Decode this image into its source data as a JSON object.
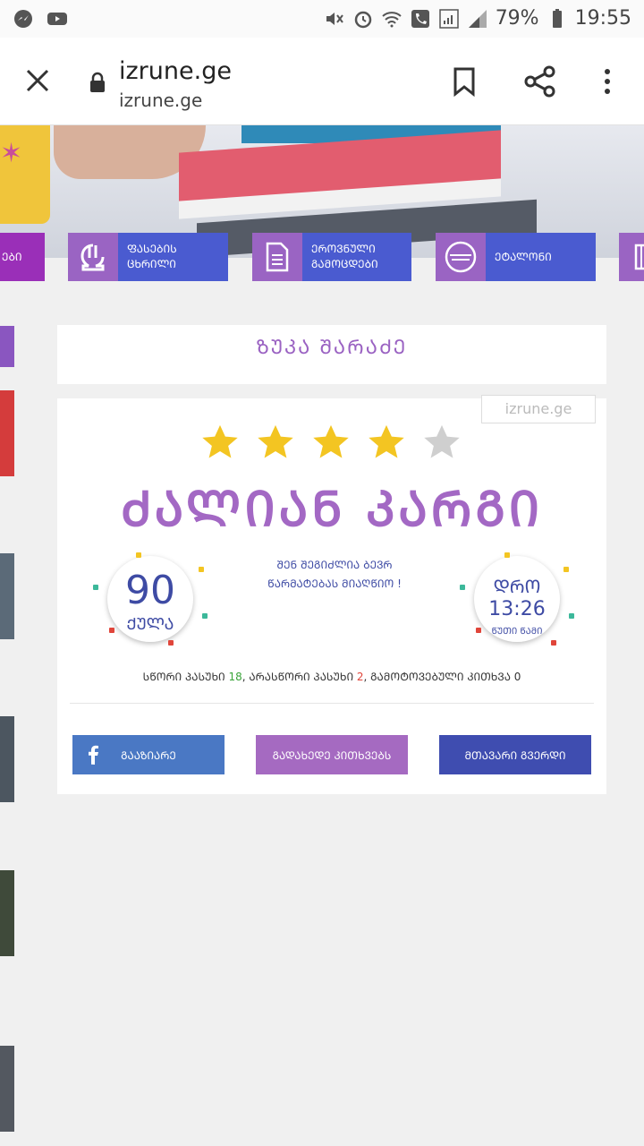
{
  "status": {
    "battery_pct": "79%",
    "time": "19:55"
  },
  "browser": {
    "page_title": "izrune.ge",
    "url": "izrune.ge"
  },
  "nav": {
    "partial_label": "ᲔᲑᲘ",
    "prices": [
      "ᲤᲐᲡᲔᲑᲘᲡ",
      "ᲪᲮᲠᲘᲚᲘ"
    ],
    "national": [
      "ᲔᲠᲝᲕᲜᲣᲚᲘ",
      "ᲒᲐᲛᲝᲪᲓᲔᲑᲘ"
    ],
    "etalon": "ᲔᲢᲐᲚᲝᲜᲘ"
  },
  "result": {
    "name": "ᲖᲣᲙᲐ ᲨᲐᲠᲐᲫᲔ",
    "watermark": "izrune.ge",
    "stars_filled": 4,
    "stars_total": 5,
    "rating_label": "ᲫᲐᲚᲘᲐᲜ ᲙᲐᲠᲒᲘ",
    "score": "90",
    "score_unit": "ᲥᲣᲚᲐ",
    "message_line1": "ᲨᲔᲜ ᲨᲔᲒᲘᲫᲚᲘᲐ ᲑᲔᲕᲠ",
    "message_line2": "ᲬᲐᲠᲛᲐᲢᲔᲑᲐᲡ ᲛᲘᲐᲦᲬᲘᲝ !",
    "time_label": "ᲓᲠᲝ",
    "time_value": "13:26",
    "time_unit": "ᲬᲣᲗᲘ ᲬᲐᲛᲘ",
    "summary": {
      "correct_label": "ᲡᲬᲝᲠᲘ ᲞᲐᲡᲣᲮᲘ",
      "correct": "18",
      "wrong_label": ", ᲐᲠᲐᲡᲬᲝᲠᲘ ᲞᲐᲡᲣᲮᲘ",
      "wrong": "2",
      "skipped_label": ", ᲒᲐᲛᲝᲢᲝᲕᲔᲑᲣᲚᲘ ᲙᲘᲗᲮᲕᲐ",
      "skipped": "0"
    },
    "buttons": {
      "share": "ᲒᲐᲐᲖᲘᲐᲠᲔ",
      "review": "ᲒᲐᲓᲐᲮᲔᲓᲔ ᲙᲘᲗᲮᲕᲔᲑᲡ",
      "home": "ᲛᲗᲐᲕᲐᲠᲘ ᲒᲕᲔᲠᲓᲘ"
    }
  },
  "colors": {
    "purple": "#9a62c2",
    "blue": "#3e4ba4",
    "facebook": "#4a78c4",
    "review_btn": "#a56ac1",
    "home_btn": "#3f4db0"
  }
}
